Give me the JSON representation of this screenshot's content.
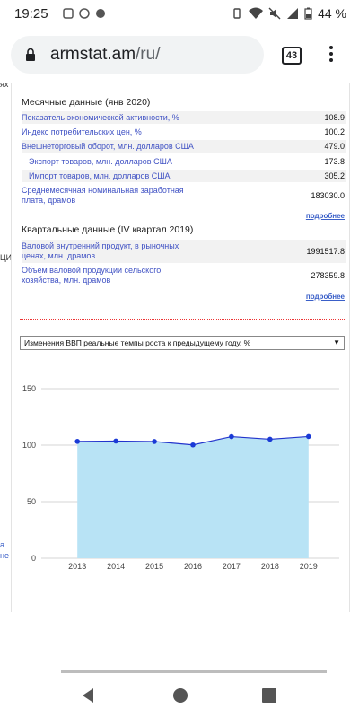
{
  "status_bar": {
    "time": "19:25",
    "battery": "44 %"
  },
  "browser": {
    "url_host": "armstat.am",
    "url_path": "/ru/",
    "tab_count": "43"
  },
  "left_fragments": [
    "ях",
    "ЦИ",
    "а",
    "не"
  ],
  "monthly": {
    "title": "Месячные данные  (янв 2020)",
    "rows": [
      {
        "label": "Показатель экономической активности, %",
        "value": "108.9"
      },
      {
        "label": "Индекс потребительских цен, %",
        "value": "100.2"
      },
      {
        "label": "Внешнеторговый оборот, млн. долларов США",
        "value": "479.0"
      },
      {
        "label": "Экспорт товаров, млн. долларов США",
        "value": "173.8"
      },
      {
        "label": "Импорт товаров, млн. долларов США",
        "value": "305.2"
      },
      {
        "label": "Среднемесячная номинальная заработная плата, драмов",
        "value": "183030.0"
      }
    ],
    "more": "подробнее"
  },
  "quarterly": {
    "title": "Квартальные данные (IV квартал 2019)",
    "rows": [
      {
        "label": "Валовой внутренний продукт, в рыночных ценах, млн. драмов",
        "value": "1991517.8"
      },
      {
        "label": "Объем валовой продукции сельского хозяйства, млн. драмов",
        "value": "278359.8"
      }
    ],
    "more": "подробнее"
  },
  "selector": {
    "selected": "Изменения ВВП реальные темпы роста к предыдущему году, %"
  },
  "chart_data": {
    "type": "area",
    "categories": [
      "2013",
      "2014",
      "2015",
      "2016",
      "2017",
      "2018",
      "2019"
    ],
    "series": [
      {
        "values": [
          103.3,
          103.6,
          103.2,
          100.2,
          107.5,
          105.2,
          107.6
        ]
      }
    ],
    "y_ticks": [
      0,
      50,
      100,
      150
    ],
    "ylim": [
      0,
      150
    ],
    "grid": true,
    "colors": {
      "fill": "#b8e3f5",
      "line": "#2233cc",
      "marker": "#1a3ad6"
    }
  }
}
